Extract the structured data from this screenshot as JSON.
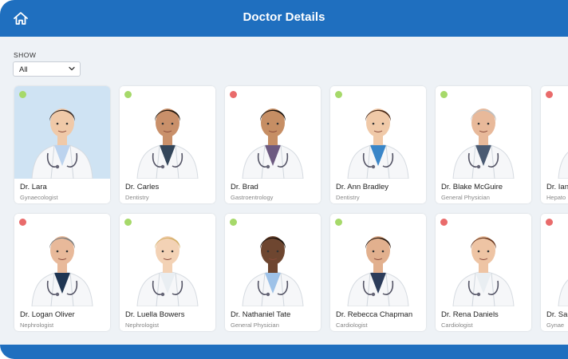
{
  "header": {
    "title": "Doctor Details",
    "icon": "home-icon",
    "color": "#1f6fbf"
  },
  "filter": {
    "label": "SHOW",
    "value": "All"
  },
  "status_colors": {
    "available": "#a6d96a",
    "unavailable": "#e96b6b"
  },
  "doctors": [
    {
      "name": "Dr. Lara",
      "specialty": "Gynaecologist",
      "status": "available",
      "coat": "#f6f7f9",
      "shirt": "#bcd3ee",
      "hair": "#3b2e28",
      "skin": "#f0c9a8",
      "photo_bg": "#cfe3f3"
    },
    {
      "name": "Dr. Carles",
      "specialty": "Dentistry",
      "status": "available",
      "coat": "#f6f7f9",
      "shirt": "#34465a",
      "hair": "#22190f",
      "skin": "#c9906a",
      "photo_bg": "#ffffff"
    },
    {
      "name": "Dr. Brad",
      "specialty": "Gastroentrology",
      "status": "unavailable",
      "coat": "#f6f7f9",
      "shirt": "#6d5a80",
      "hair": "#1a140f",
      "skin": "#c68e64",
      "photo_bg": "#ffffff"
    },
    {
      "name": "Dr. Ann Bradley",
      "specialty": "Dentistry",
      "status": "available",
      "coat": "#f6f7f9",
      "shirt": "#3a86c8",
      "hair": "#4a2a18",
      "skin": "#f0c9a8",
      "photo_bg": "#ffffff"
    },
    {
      "name": "Dr. Blake McGuire",
      "specialty": "General Physician",
      "status": "available",
      "coat": "#f6f7f9",
      "shirt": "#4a5a72",
      "hair": "#bfbfbf",
      "skin": "#e8b99a",
      "photo_bg": "#ffffff"
    },
    {
      "name": "Dr. Ian",
      "specialty": "Hepato",
      "status": "unavailable",
      "coat": "#f6f7f9",
      "shirt": "#cccccc",
      "hair": "#7a6a5a",
      "skin": "#e8c2a0",
      "photo_bg": "#ffffff"
    },
    {
      "name": "Dr. Logan Oliver",
      "specialty": "Nephrologist",
      "status": "unavailable",
      "coat": "#f6f7f9",
      "shirt": "#1f3552",
      "hair": "#7d7d7d",
      "skin": "#e8b99a",
      "photo_bg": "#ffffff"
    },
    {
      "name": "Dr. Luella Bowers",
      "specialty": "Nephrologist",
      "status": "available",
      "coat": "#f6f7f9",
      "shirt": "#e9eef2",
      "hair": "#d4b06a",
      "skin": "#f3d2b5",
      "photo_bg": "#ffffff"
    },
    {
      "name": "Dr. Nathaniel Tate",
      "specialty": "General Physician",
      "status": "available",
      "coat": "#f6f7f9",
      "shirt": "#9ec2e8",
      "hair": "#1a120c",
      "skin": "#6e4630",
      "photo_bg": "#ffffff"
    },
    {
      "name": "Dr. Rebecca Chapman",
      "specialty": "Cardiologist",
      "status": "available",
      "coat": "#f6f7f9",
      "shirt": "#2c3c5a",
      "hair": "#2a1a10",
      "skin": "#e2b08e",
      "photo_bg": "#ffffff"
    },
    {
      "name": "Dr. Rena Daniels",
      "specialty": "Cardiologist",
      "status": "unavailable",
      "coat": "#f6f7f9",
      "shirt": "#e9eef2",
      "hair": "#6b3a22",
      "skin": "#eec4a4",
      "photo_bg": "#ffffff"
    },
    {
      "name": "Dr. Sa",
      "specialty": "Gynae",
      "status": "unavailable",
      "coat": "#f6f7f9",
      "shirt": "#dddddd",
      "hair": "#6a5040",
      "skin": "#eec4a4",
      "photo_bg": "#ffffff"
    }
  ]
}
